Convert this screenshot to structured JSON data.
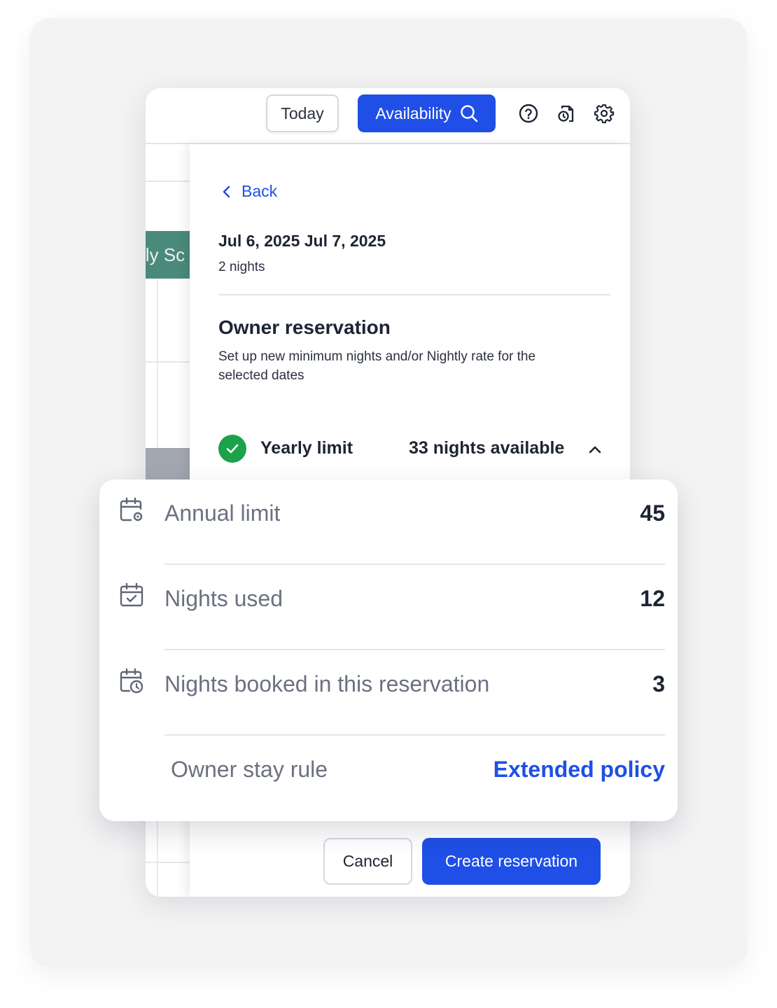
{
  "toolbar": {
    "today_label": "Today",
    "availability_label": "Availability",
    "icons": [
      "search-icon",
      "help-icon",
      "document-clock-icon",
      "gear-icon"
    ]
  },
  "calendar": {
    "event_label": "ily Sc"
  },
  "panel": {
    "back_label": "Back",
    "dates": "Jul 6, 2025 Jul 7, 2025",
    "nights": "2 nights",
    "section_title": "Owner reservation",
    "section_description": "Set up new minimum nights and/or Nightly rate for the selected dates",
    "yearly_limit": {
      "label": "Yearly limit",
      "value": "33 nights available",
      "status_color": "#1ba24a"
    },
    "cancel_label": "Cancel",
    "create_label": "Create reservation"
  },
  "limit_card": {
    "rows": [
      {
        "icon": "calendar-gear-icon",
        "label": "Annual limit",
        "value": "45"
      },
      {
        "icon": "calendar-check-icon",
        "label": "Nights used",
        "value": "12"
      },
      {
        "icon": "calendar-clock-icon",
        "label": "Nights booked in this reservation",
        "value": "3"
      }
    ],
    "rule_label": "Owner stay rule",
    "rule_value": "Extended policy"
  },
  "colors": {
    "accent": "#1f4fe6",
    "success": "#1ba24a",
    "event": "#4b8a7a"
  }
}
